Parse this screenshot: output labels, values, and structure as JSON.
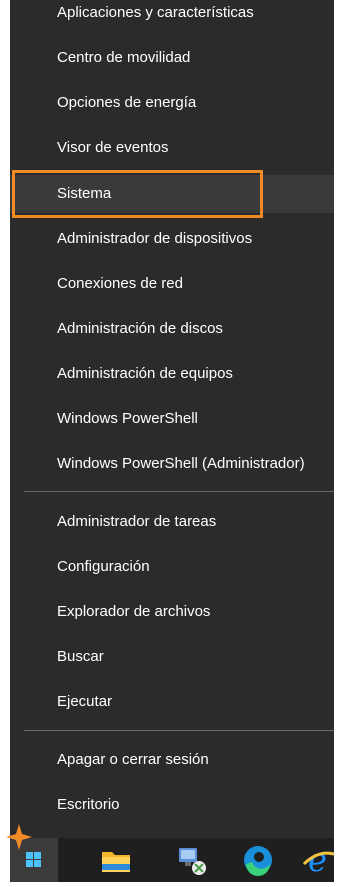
{
  "menu": {
    "items": [
      {
        "label": "Aplicaciones y características"
      },
      {
        "label": "Centro de movilidad"
      },
      {
        "label": "Opciones de energía"
      },
      {
        "label": "Visor de eventos"
      },
      {
        "label": "Sistema"
      },
      {
        "label": "Administrador de dispositivos"
      },
      {
        "label": "Conexiones de red"
      },
      {
        "label": "Administración de discos"
      },
      {
        "label": "Administración de equipos"
      },
      {
        "label": "Windows PowerShell"
      },
      {
        "label": "Windows PowerShell (Administrador)"
      },
      {
        "label": "Administrador de tareas"
      },
      {
        "label": "Configuración"
      },
      {
        "label": "Explorador de archivos"
      },
      {
        "label": "Buscar"
      },
      {
        "label": "Ejecutar"
      },
      {
        "label": "Apagar o cerrar sesión"
      },
      {
        "label": "Escritorio"
      }
    ],
    "highlighted_item": "Sistema",
    "highlight_color": "#f08a24"
  },
  "taskbar": {
    "buttons": [
      {
        "icon": "windows-start-icon"
      },
      {
        "icon": "file-explorer-icon"
      },
      {
        "icon": "network-computer-icon"
      },
      {
        "icon": "edge-icon"
      },
      {
        "icon": "internet-explorer-icon"
      }
    ]
  }
}
